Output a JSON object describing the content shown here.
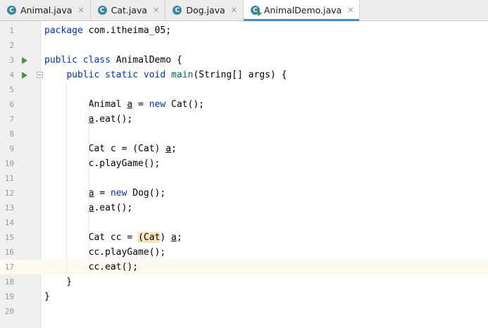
{
  "tabs": [
    {
      "label": "Animal.java",
      "icon": "class-icon",
      "active": false
    },
    {
      "label": "Cat.java",
      "icon": "class-icon",
      "active": false
    },
    {
      "label": "Dog.java",
      "icon": "class-icon",
      "active": false
    },
    {
      "label": "AnimalDemo.java",
      "icon": "runnable-class-icon",
      "active": true
    }
  ],
  "tab_icon_glyph": "C",
  "close_glyph": "✕",
  "editor": {
    "current_line": 17,
    "lines": [
      {
        "n": "1",
        "code": "package com.itheima_05;"
      },
      {
        "n": "2",
        "code": ""
      },
      {
        "n": "3",
        "code": "public class AnimalDemo {",
        "run": true
      },
      {
        "n": "4",
        "code": "    public static void main(String[] args) {",
        "run": true,
        "fold": true
      },
      {
        "n": "5",
        "code": ""
      },
      {
        "n": "6",
        "code": "        Animal a = new Cat();"
      },
      {
        "n": "7",
        "code": "        a.eat();"
      },
      {
        "n": "8",
        "code": ""
      },
      {
        "n": "9",
        "code": "        Cat c = (Cat) a;"
      },
      {
        "n": "10",
        "code": "        c.playGame();"
      },
      {
        "n": "11",
        "code": ""
      },
      {
        "n": "12",
        "code": "        a = new Dog();"
      },
      {
        "n": "13",
        "code": "        a.eat();"
      },
      {
        "n": "14",
        "code": ""
      },
      {
        "n": "15",
        "code": "        Cat cc = (Cat) a;"
      },
      {
        "n": "16",
        "code": "        cc.playGame();"
      },
      {
        "n": "17",
        "code": "        cc.eat();"
      },
      {
        "n": "18",
        "code": "    }"
      },
      {
        "n": "19",
        "code": "}"
      },
      {
        "n": "20",
        "code": ""
      }
    ]
  },
  "colors": {
    "keyword": "#0033b3",
    "method_decl": "#00627a",
    "current_line_bg": "#fcfaed",
    "run_gutter": "#3d9b3d",
    "tab_underline": "#4a88c7"
  }
}
